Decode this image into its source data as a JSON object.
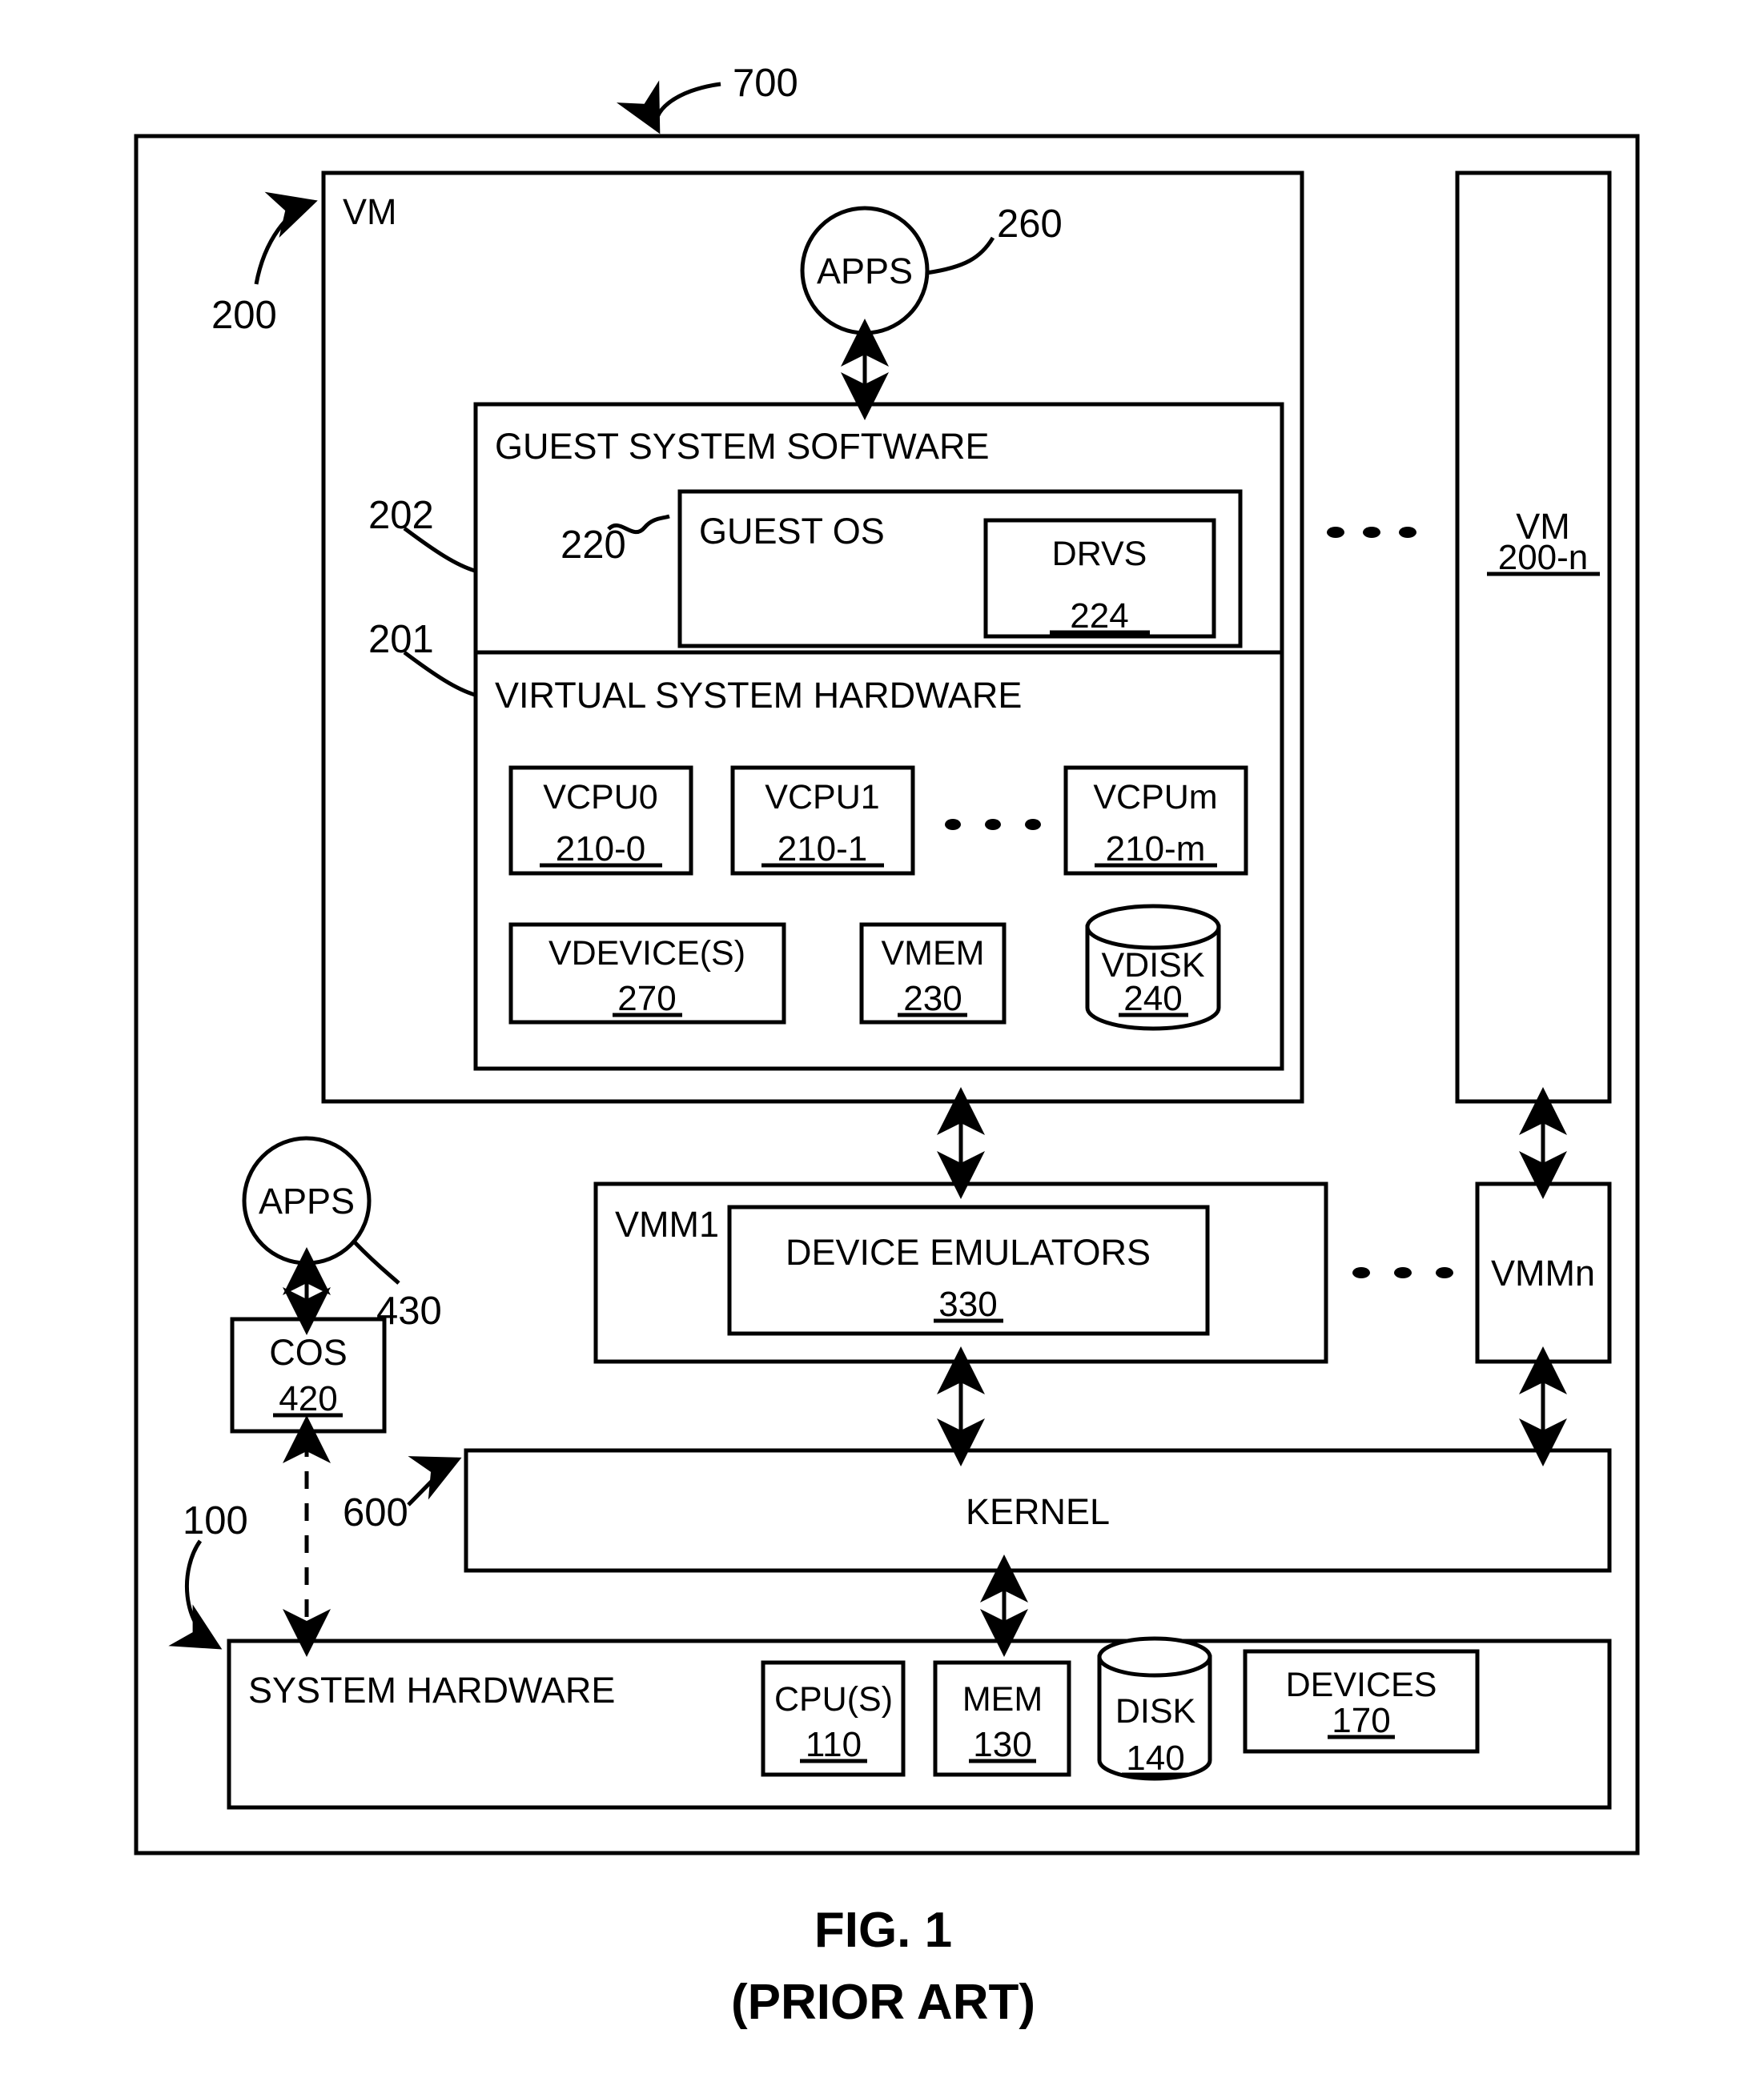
{
  "figure": {
    "caption_line1": "FIG. 1",
    "caption_line2": "(PRIOR ART)",
    "outer_ref": "700"
  },
  "vm": {
    "label": "VM",
    "ref": "200",
    "apps": {
      "label": "APPS",
      "ref": "260"
    },
    "guest_system_software": {
      "label": "GUEST SYSTEM SOFTWARE",
      "ref": "202",
      "guest_os": {
        "label": "GUEST OS",
        "ref": "220",
        "drvs": {
          "label": "DRVS",
          "number": "224"
        }
      }
    },
    "virtual_system_hardware": {
      "label": "VIRTUAL SYSTEM HARDWARE",
      "ref": "201",
      "vcpus": [
        {
          "label": "VCPU0",
          "number": "210-0"
        },
        {
          "label": "VCPU1",
          "number": "210-1"
        },
        {
          "label": "VCPUm",
          "number": "210-m"
        }
      ],
      "vcpu_ellipsis": ". . .",
      "devices": [
        {
          "label": "VDEVICE(S)",
          "number": "270",
          "shape": "rect"
        },
        {
          "label": "VMEM",
          "number": "230",
          "shape": "rect"
        },
        {
          "label": "VDISK",
          "number": "240",
          "shape": "cylinder"
        }
      ]
    }
  },
  "vm_n": {
    "label": "VM",
    "number": "200-n",
    "ellipsis": ". . ."
  },
  "vmm1": {
    "label": "VMM1",
    "device_emulators": {
      "label": "DEVICE EMULATORS",
      "number": "330"
    }
  },
  "vmm_n": {
    "label": "VMMn",
    "ellipsis": ". . ."
  },
  "cos_stack": {
    "apps": {
      "label": "APPS",
      "ref": "430"
    },
    "cos": {
      "label": "COS",
      "number": "420"
    }
  },
  "kernel": {
    "label": "KERNEL",
    "ref": "600"
  },
  "system_hardware": {
    "label": "SYSTEM HARDWARE",
    "ref": "100",
    "components": [
      {
        "label": "CPU(S)",
        "number": "110",
        "shape": "rect"
      },
      {
        "label": "MEM",
        "number": "130",
        "shape": "rect"
      },
      {
        "label": "DISK",
        "number": "140",
        "shape": "cylinder"
      },
      {
        "label": "DEVICES",
        "number": "170",
        "shape": "rect"
      }
    ]
  },
  "colors": {
    "ink": "#000000",
    "paper": "#ffffff"
  }
}
